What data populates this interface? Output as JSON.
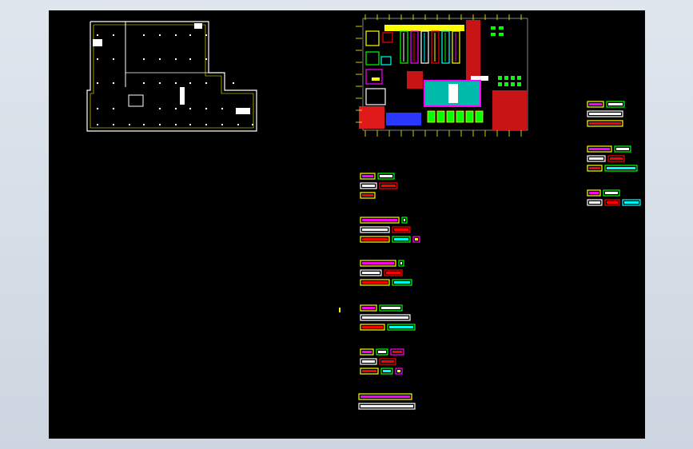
{
  "viewer": {
    "background": "#000000",
    "frame_color": "#d5dde6"
  },
  "palette": {
    "line": "#ffffff",
    "wall": "#ffff00",
    "accent_green": "#00ff00",
    "accent_red": "#ff0000",
    "accent_magenta": "#ff00ff",
    "accent_blue": "#0000ff",
    "hatch_red": "#c81414"
  },
  "drawing_left": {
    "name": "floor-plan-structural",
    "stroke": "#ffffff"
  },
  "drawing_right": {
    "name": "floor-plan-furnished",
    "hatch_color": "#c81414"
  },
  "detail_groups": {
    "count_left_column": 6,
    "count_right_column": 3
  }
}
